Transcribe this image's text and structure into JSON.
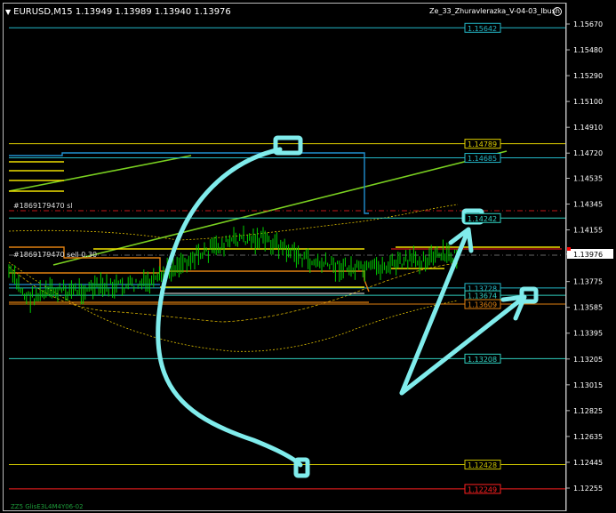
{
  "header": {
    "symbol_label": "EURUSD,M15",
    "ohlc": "1.13949 1.13989 1.13940 1.13976"
  },
  "ea": {
    "name": "Ze_33_Zhuravlerazka_V-04-03_Ibush"
  },
  "price_axis": {
    "ticks": [
      "1.15670",
      "1.15480",
      "1.15290",
      "1.15100",
      "1.14910",
      "1.14720",
      "1.14535",
      "1.14345",
      "1.14155",
      "1.13976",
      "1.13775",
      "1.13585",
      "1.13395",
      "1.13205",
      "1.13015",
      "1.12825",
      "1.12635",
      "1.12445",
      "1.12255"
    ],
    "current_price": "1.13976",
    "current_price_bg": "#ffffff",
    "marker_red": "#ff0000"
  },
  "levels": [
    {
      "price": "1.15642",
      "color": "#23b8c8"
    },
    {
      "price": "1.14789",
      "color": "#e0d000"
    },
    {
      "price": "1.14685",
      "color": "#23b8c8"
    },
    {
      "price": "1.14242",
      "color": "#30d0c0"
    },
    {
      "price": "1.13728",
      "color": "#23b8c8"
    },
    {
      "price": "1.13674",
      "color": "#30d0c0"
    },
    {
      "price": "1.13609",
      "color": "#e08010"
    },
    {
      "price": "1.13208",
      "color": "#30d0c0"
    },
    {
      "price": "1.12428",
      "color": "#c8c000"
    },
    {
      "price": "1.12249",
      "color": "#ff2020"
    }
  ],
  "order_labels": {
    "sl": "#1869179470 sl",
    "entry": "#1869179470 sell 0.30"
  },
  "footer": {
    "indicator": "ZZ5 GlisE3L4M4Y06-02"
  },
  "colors": {
    "background": "#000000",
    "candles": "#00d000",
    "annotation": "#80ecec"
  }
}
